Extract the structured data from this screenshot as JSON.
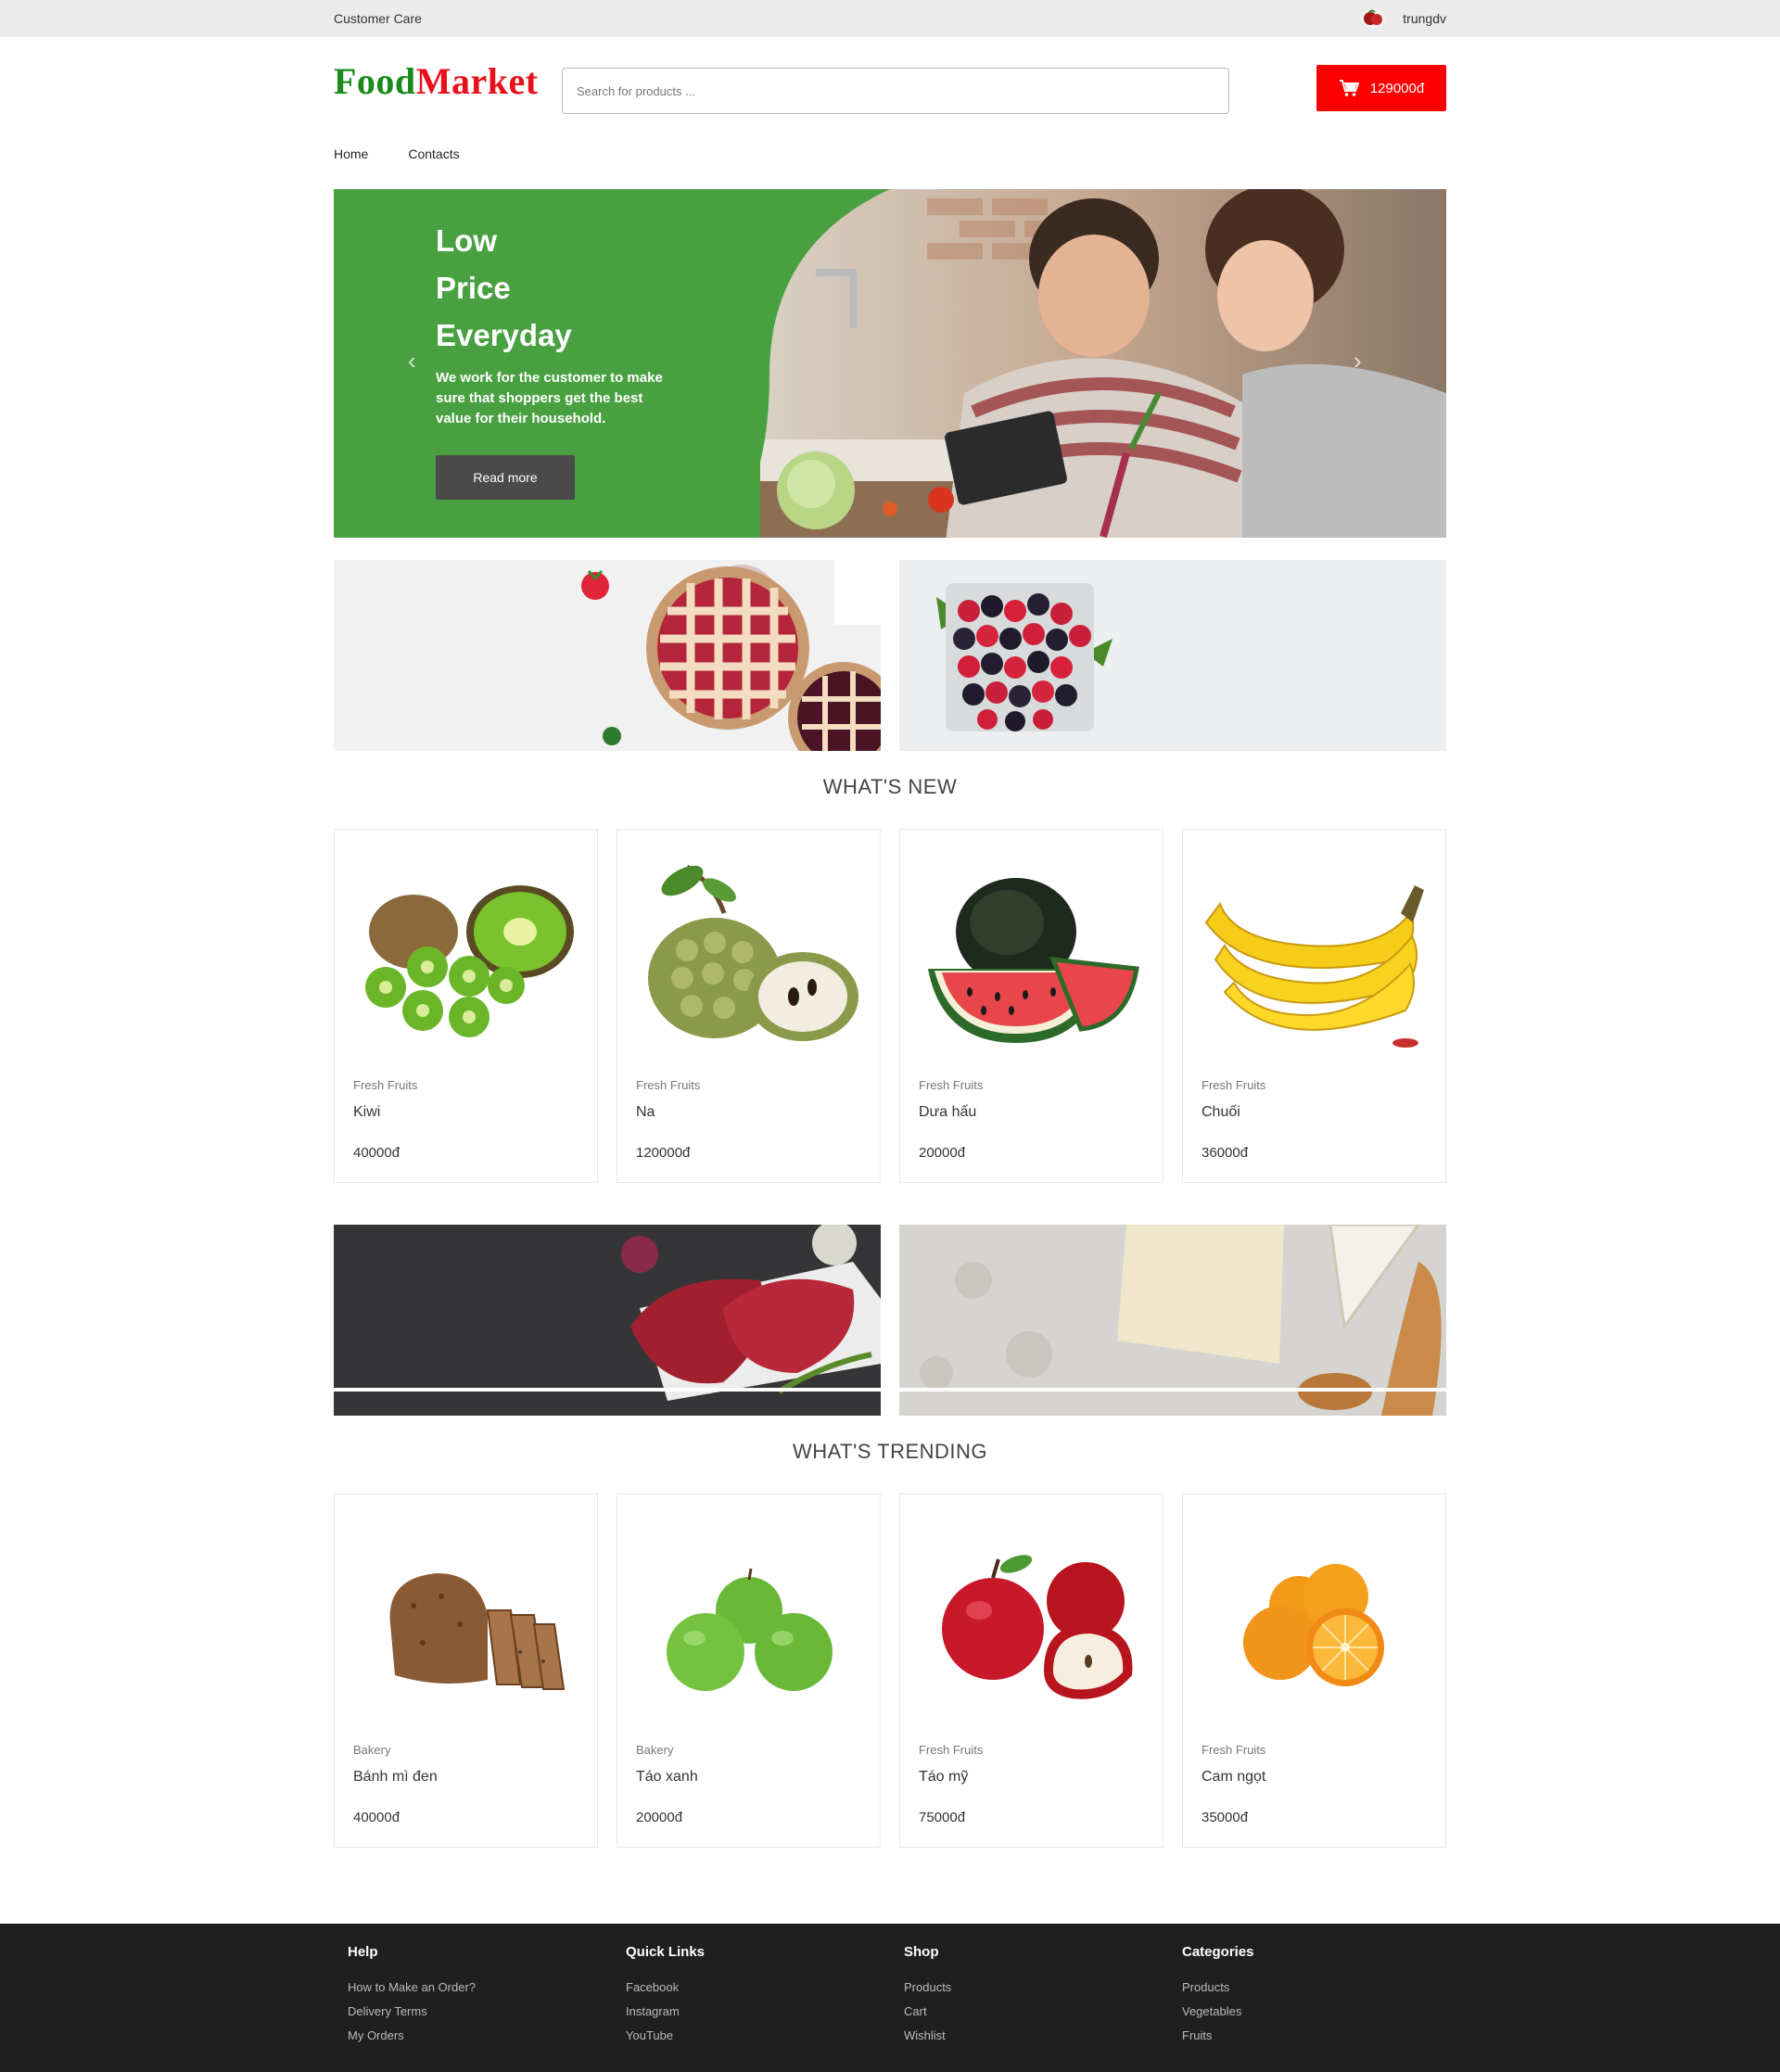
{
  "topbar": {
    "customer_care": "Customer Care",
    "username": "trungdv"
  },
  "header": {
    "logo_part1": "Food",
    "logo_part2": "Market",
    "search_placeholder": "Search for products ...",
    "cart_total": "129000đ"
  },
  "nav": {
    "items": [
      "Home",
      "Contacts"
    ]
  },
  "hero": {
    "title_lines": [
      "Low",
      "Price",
      "Everyday"
    ],
    "subtitle": "We work for the customer to make sure that shoppers get the best value for their household.",
    "button_label": "Read more"
  },
  "sections": {
    "whats_new": {
      "title": "WHAT'S NEW",
      "products": [
        {
          "category": "Fresh Fruits",
          "name": "Kiwi",
          "price": "40000đ"
        },
        {
          "category": "Fresh Fruits",
          "name": "Na",
          "price": "120000đ"
        },
        {
          "category": "Fresh Fruits",
          "name": "Dưa hấu",
          "price": "20000đ"
        },
        {
          "category": "Fresh Fruits",
          "name": "Chuối",
          "price": "36000đ"
        }
      ]
    },
    "whats_trending": {
      "title": "WHAT'S TRENDING",
      "products": [
        {
          "category": "Bakery",
          "name": "Bánh mì đen",
          "price": "40000đ"
        },
        {
          "category": "Bakery",
          "name": "Táo xanh",
          "price": "20000đ"
        },
        {
          "category": "Fresh Fruits",
          "name": "Táo mỹ",
          "price": "75000đ"
        },
        {
          "category": "Fresh Fruits",
          "name": "Cam ngọt",
          "price": "35000đ"
        }
      ]
    }
  },
  "footer": {
    "columns": [
      {
        "title": "Help",
        "links": [
          "How to Make an Order?",
          "Delivery Terms",
          "My Orders"
        ]
      },
      {
        "title": "Quick Links",
        "links": [
          "Facebook",
          "Instagram",
          "YouTube"
        ]
      },
      {
        "title": "Shop",
        "links": [
          "Products",
          "Cart",
          "Wishlist"
        ]
      },
      {
        "title": "Categories",
        "links": [
          "Products",
          "Vegetables",
          "Fruits"
        ]
      }
    ]
  },
  "colors": {
    "brand_green": "#1a8a1a",
    "brand_red": "#e8101a",
    "hero_green": "#49a041",
    "cart_red": "#ff0000",
    "footer_bg": "#1f1f1f"
  }
}
